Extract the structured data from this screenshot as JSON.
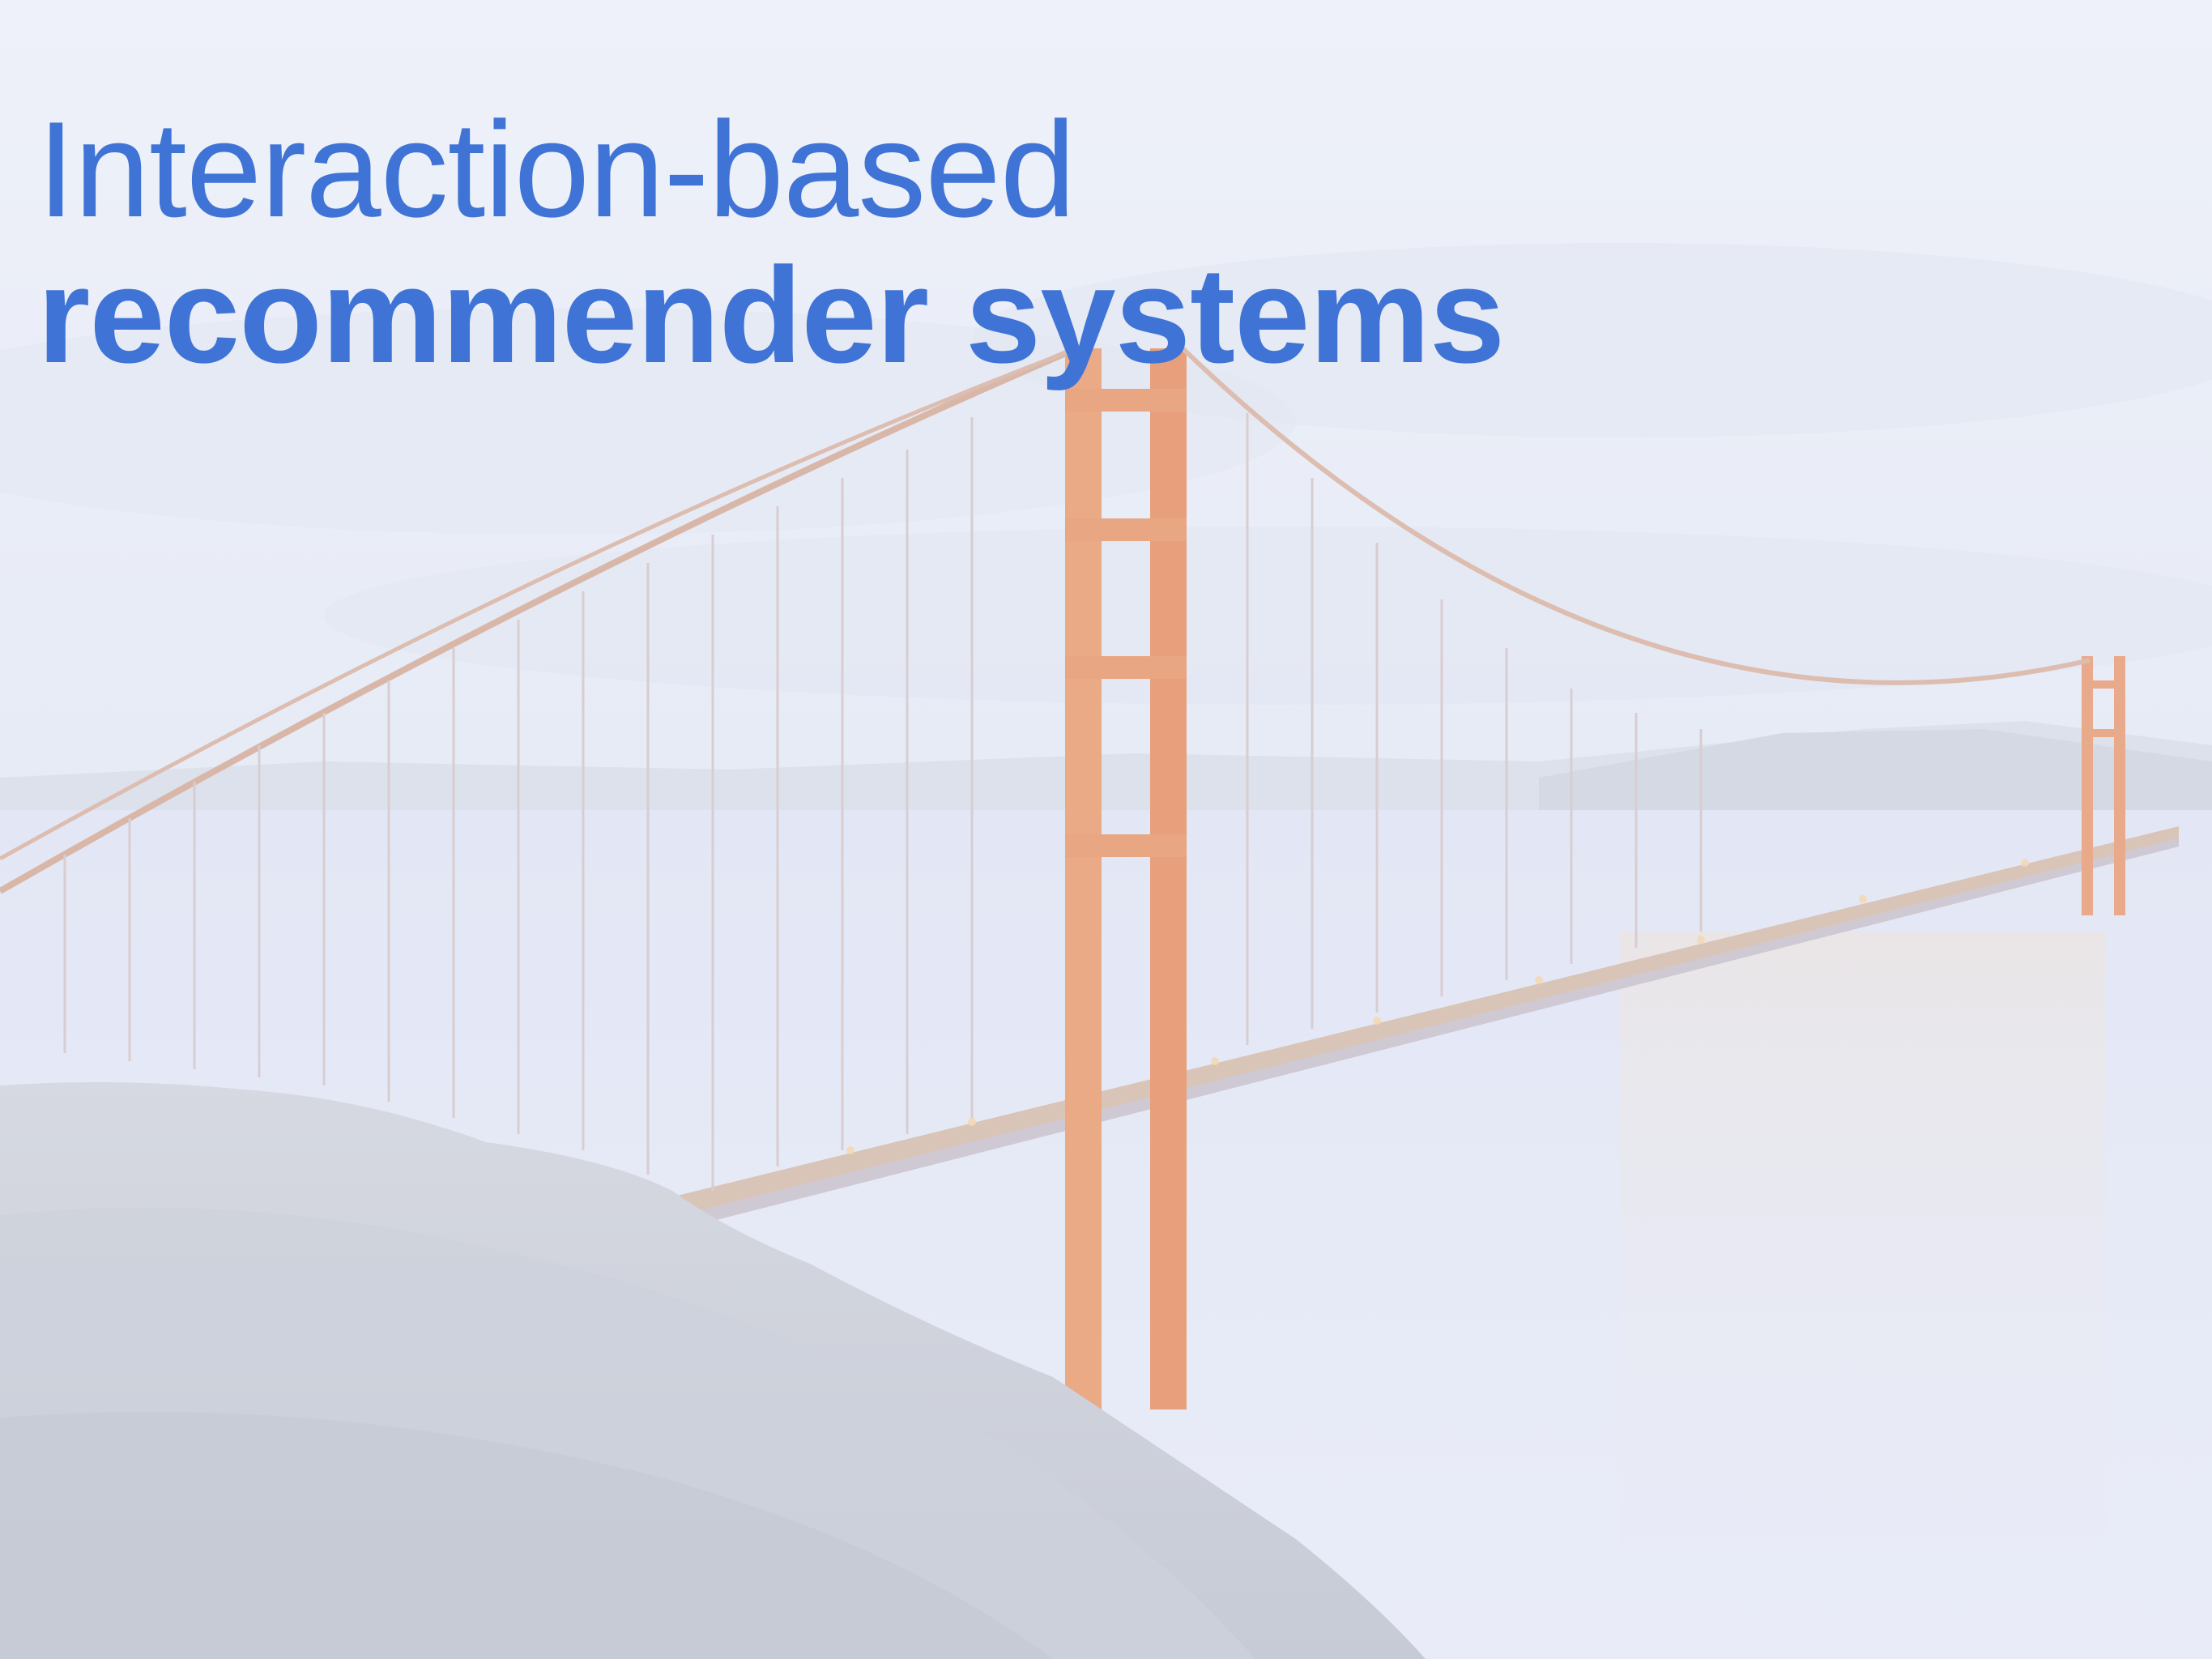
{
  "slide": {
    "title_line1": "Interaction-based",
    "title_line2": "recommender systems",
    "background_image": "golden-gate-bridge-photo",
    "colors": {
      "title": "#3f74d6",
      "sky": "#e8ecf7",
      "bridge": "#e9a07a",
      "water": "#e2e7f6",
      "rock": "#c9cdd8"
    }
  }
}
